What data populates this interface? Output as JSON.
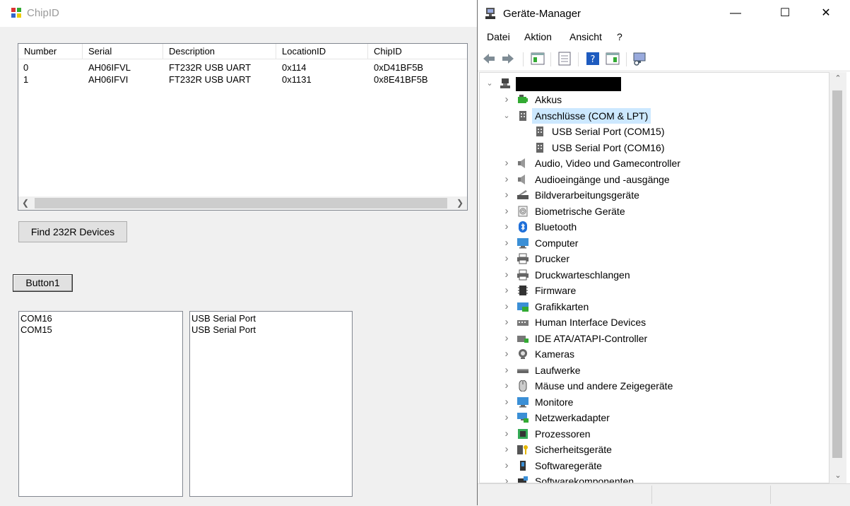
{
  "chipid_window": {
    "title": "ChipID",
    "listview": {
      "columns": [
        "Number",
        "Serial",
        "Description",
        "LocationID",
        "ChipID"
      ],
      "rows": [
        [
          "0",
          "AH06IFVL",
          "FT232R USB UART",
          "0x114",
          "0xD41BF5B"
        ],
        [
          "1",
          "AH06IFVI",
          "FT232R USB UART",
          "0x1131",
          "0x8E41BF5B"
        ]
      ]
    },
    "find_button": "Find 232R Devices",
    "button1": "Button1",
    "ports_list": [
      "COM16",
      "COM15"
    ],
    "names_list": [
      "USB Serial Port",
      "USB Serial Port"
    ]
  },
  "device_manager": {
    "title": "Geräte-Manager",
    "caption_buttons": {
      "minimize": "—",
      "maximize": "☐",
      "close": "✕"
    },
    "menu": [
      "Datei",
      "Aktion",
      "Ansicht",
      "?"
    ],
    "toolbar_icons": [
      "back-icon",
      "forward-icon",
      "properties-icon",
      "update-driver-icon",
      "help-icon",
      "view-icon",
      "scan-hardware-icon"
    ],
    "tree": {
      "root_label": "",
      "categories": [
        {
          "label": "Akkus",
          "icon": "battery-icon",
          "expanded": false
        },
        {
          "label": "Anschlüsse (COM & LPT)",
          "icon": "port-icon",
          "expanded": true,
          "selected": true,
          "children": [
            "USB Serial Port (COM15)",
            "USB Serial Port (COM16)"
          ]
        },
        {
          "label": "Audio, Video und Gamecontroller",
          "icon": "speaker-icon",
          "expanded": false
        },
        {
          "label": "Audioeingänge und -ausgänge",
          "icon": "speaker-icon",
          "expanded": false
        },
        {
          "label": "Bildverarbeitungsgeräte",
          "icon": "scanner-icon",
          "expanded": false
        },
        {
          "label": "Biometrische Geräte",
          "icon": "fingerprint-icon",
          "expanded": false
        },
        {
          "label": "Bluetooth",
          "icon": "bluetooth-icon",
          "expanded": false
        },
        {
          "label": "Computer",
          "icon": "monitor-icon",
          "expanded": false
        },
        {
          "label": "Drucker",
          "icon": "printer-icon",
          "expanded": false
        },
        {
          "label": "Druckwarteschlangen",
          "icon": "printer-icon",
          "expanded": false
        },
        {
          "label": "Firmware",
          "icon": "chip-icon",
          "expanded": false
        },
        {
          "label": "Grafikkarten",
          "icon": "display-adapter-icon",
          "expanded": false
        },
        {
          "label": "Human Interface Devices",
          "icon": "keyboard-icon",
          "expanded": false
        },
        {
          "label": "IDE ATA/ATAPI-Controller",
          "icon": "ide-controller-icon",
          "expanded": false
        },
        {
          "label": "Kameras",
          "icon": "camera-icon",
          "expanded": false
        },
        {
          "label": "Laufwerke",
          "icon": "drive-icon",
          "expanded": false
        },
        {
          "label": "Mäuse und andere Zeigegeräte",
          "icon": "mouse-icon",
          "expanded": false
        },
        {
          "label": "Monitore",
          "icon": "monitor-icon",
          "expanded": false
        },
        {
          "label": "Netzwerkadapter",
          "icon": "network-icon",
          "expanded": false
        },
        {
          "label": "Prozessoren",
          "icon": "cpu-icon",
          "expanded": false
        },
        {
          "label": "Sicherheitsgeräte",
          "icon": "security-icon",
          "expanded": false
        },
        {
          "label": "Softwaregeräte",
          "icon": "software-device-icon",
          "expanded": false
        },
        {
          "label": "Softwarekomponenten",
          "icon": "software-component-icon",
          "expanded": false
        }
      ]
    }
  },
  "colors": {
    "selection": "#cce8ff",
    "window_bg": "#f0f0f0",
    "help_icon": "#1e5bbf"
  }
}
